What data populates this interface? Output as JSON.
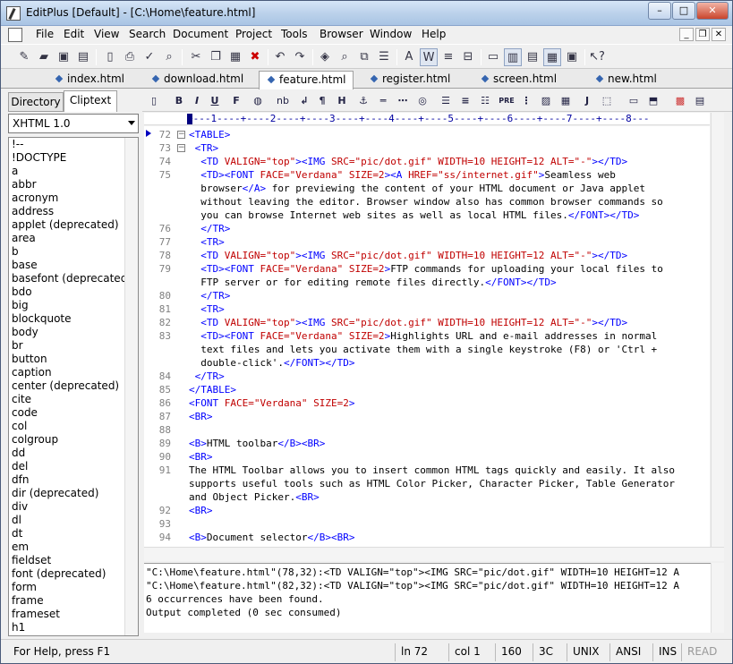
{
  "window": {
    "title": "EditPlus [Default] - [C:\\Home\\feature.html]"
  },
  "menu": [
    "File",
    "Edit",
    "View",
    "Search",
    "Document",
    "Project",
    "Tools",
    "Browser",
    "Window",
    "Help"
  ],
  "file_tabs": [
    {
      "label": "index.html",
      "active": false
    },
    {
      "label": "download.html",
      "active": false
    },
    {
      "label": "feature.html",
      "active": true
    },
    {
      "label": "register.html",
      "active": false
    },
    {
      "label": "screen.html",
      "active": false
    },
    {
      "label": "new.html",
      "active": false
    }
  ],
  "left_panel": {
    "tabs": [
      "Directory",
      "Cliptext"
    ],
    "doc_selector": "XHTML 1.0",
    "tags": [
      "!--",
      "!DOCTYPE",
      "a",
      "abbr",
      "acronym",
      "address",
      "applet (deprecated)",
      "area",
      "b",
      "base",
      "basefont (deprecated)",
      "bdo",
      "big",
      "blockquote",
      "body",
      "br",
      "button",
      "caption",
      "center (deprecated)",
      "cite",
      "code",
      "col",
      "colgroup",
      "dd",
      "del",
      "dfn",
      "dir (deprecated)",
      "div",
      "dl",
      "dt",
      "em",
      "fieldset",
      "font (deprecated)",
      "form",
      "frame",
      "frameset",
      "h1"
    ]
  },
  "html_toolbar": [
    "B",
    "I",
    "U",
    "F",
    "nb",
    "¶",
    "H"
  ],
  "ruler": "+---1----+----2----+----3----+----4----+----5----+----6----+----7----+----8---",
  "editor": {
    "lines": [
      {
        "n": "72",
        "parts": [
          [
            "tg",
            "<TABLE>"
          ]
        ]
      },
      {
        "n": "73",
        "parts": [
          [
            "tg",
            " <TR>"
          ]
        ]
      },
      {
        "n": "74",
        "parts": [
          [
            "tg",
            "  <TD "
          ],
          [
            "at",
            "VALIGN=\"top\""
          ],
          [
            "tg",
            "><IMG "
          ],
          [
            "at",
            "SRC=\"pic/dot.gif\" WIDTH=10 HEIGHT=12 ALT=\"-\""
          ],
          [
            "tg",
            "></TD>"
          ]
        ]
      },
      {
        "n": "75",
        "parts": [
          [
            "tg",
            "  <TD><FONT "
          ],
          [
            "at",
            "FACE=\"Verdana\" SIZE=2"
          ],
          [
            "tg",
            "><A "
          ],
          [
            "at",
            "HREF=\"ss/internet.gif\""
          ],
          [
            "tg",
            ">"
          ],
          [
            "tx",
            "Seamless web"
          ]
        ]
      },
      {
        "n": "",
        "parts": [
          [
            "tx",
            "  browser"
          ],
          [
            "tg",
            "</A>"
          ],
          [
            "tx",
            " for previewing the content of your HTML document or Java applet"
          ]
        ]
      },
      {
        "n": "",
        "parts": [
          [
            "tx",
            "  without leaving the editor. Browser window also has common browser commands so"
          ]
        ]
      },
      {
        "n": "",
        "parts": [
          [
            "tx",
            "  you can browse Internet web sites as well as local HTML files."
          ],
          [
            "tg",
            "</FONT></TD>"
          ]
        ]
      },
      {
        "n": "76",
        "parts": [
          [
            "tg",
            "  </TR>"
          ]
        ]
      },
      {
        "n": "77",
        "parts": [
          [
            "tg",
            "  <TR>"
          ]
        ]
      },
      {
        "n": "78",
        "parts": [
          [
            "tg",
            "  <TD "
          ],
          [
            "at",
            "VALIGN=\"top\""
          ],
          [
            "tg",
            "><IMG "
          ],
          [
            "at",
            "SRC=\"pic/dot.gif\" WIDTH=10 HEIGHT=12 ALT=\"-\""
          ],
          [
            "tg",
            "></TD>"
          ]
        ]
      },
      {
        "n": "79",
        "parts": [
          [
            "tg",
            "  <TD><FONT "
          ],
          [
            "at",
            "FACE=\"Verdana\" SIZE=2"
          ],
          [
            "tg",
            ">"
          ],
          [
            "tx",
            "FTP commands for uploading your local files to"
          ]
        ]
      },
      {
        "n": "",
        "parts": [
          [
            "tx",
            "  FTP server or for editing remote files directly."
          ],
          [
            "tg",
            "</FONT></TD>"
          ]
        ]
      },
      {
        "n": "80",
        "parts": [
          [
            "tg",
            "  </TR>"
          ]
        ]
      },
      {
        "n": "81",
        "parts": [
          [
            "tg",
            "  <TR>"
          ]
        ]
      },
      {
        "n": "82",
        "parts": [
          [
            "tg",
            "  <TD "
          ],
          [
            "at",
            "VALIGN=\"top\""
          ],
          [
            "tg",
            "><IMG "
          ],
          [
            "at",
            "SRC=\"pic/dot.gif\" WIDTH=10 HEIGHT=12 ALT=\"-\""
          ],
          [
            "tg",
            "></TD>"
          ]
        ]
      },
      {
        "n": "83",
        "parts": [
          [
            "tg",
            "  <TD><FONT "
          ],
          [
            "at",
            "FACE=\"Verdana\" SIZE=2"
          ],
          [
            "tg",
            ">"
          ],
          [
            "tx",
            "Highlights URL and e-mail addresses in normal"
          ]
        ]
      },
      {
        "n": "",
        "parts": [
          [
            "tx",
            "  text files and lets you activate them with a single keystroke (F8) or 'Ctrl +"
          ]
        ]
      },
      {
        "n": "",
        "parts": [
          [
            "tx",
            "  double-click'."
          ],
          [
            "tg",
            "</FONT></TD>"
          ]
        ]
      },
      {
        "n": "84",
        "parts": [
          [
            "tg",
            " </TR>"
          ]
        ]
      },
      {
        "n": "85",
        "parts": [
          [
            "tg",
            "</TABLE>"
          ]
        ]
      },
      {
        "n": "86",
        "parts": [
          [
            "tg",
            "<FONT "
          ],
          [
            "at",
            "FACE=\"Verdana\" SIZE=2"
          ],
          [
            "tg",
            ">"
          ]
        ]
      },
      {
        "n": "87",
        "parts": [
          [
            "tg",
            "<BR>"
          ]
        ]
      },
      {
        "n": "88",
        "parts": []
      },
      {
        "n": "89",
        "parts": [
          [
            "tg",
            "<B>"
          ],
          [
            "tx",
            "HTML toolbar"
          ],
          [
            "tg",
            "</B><BR>"
          ]
        ]
      },
      {
        "n": "90",
        "parts": [
          [
            "tg",
            "<BR>"
          ]
        ]
      },
      {
        "n": "91",
        "parts": [
          [
            "tx",
            "The HTML Toolbar allows you to insert common HTML tags quickly and easily. It also"
          ]
        ]
      },
      {
        "n": "",
        "parts": [
          [
            "tx",
            "supports useful tools such as HTML Color Picker, Character Picker, Table Generator"
          ]
        ]
      },
      {
        "n": "",
        "parts": [
          [
            "tx",
            "and Object Picker."
          ],
          [
            "tg",
            "<BR>"
          ]
        ]
      },
      {
        "n": "92",
        "parts": [
          [
            "tg",
            "<BR>"
          ]
        ]
      },
      {
        "n": "93",
        "parts": []
      },
      {
        "n": "94",
        "parts": [
          [
            "tg",
            "<B>"
          ],
          [
            "tx",
            "Document selector"
          ],
          [
            "tg",
            "</B><BR>"
          ]
        ]
      }
    ]
  },
  "output": [
    "\"C:\\Home\\feature.html\"(78,32):<TD VALIGN=\"top\"><IMG SRC=\"pic/dot.gif\" WIDTH=10 HEIGHT=12 A",
    "\"C:\\Home\\feature.html\"(82,32):<TD VALIGN=\"top\"><IMG SRC=\"pic/dot.gif\" WIDTH=10 HEIGHT=12 A",
    "6 occurrences have been found.",
    "Output completed (0 sec consumed)"
  ],
  "status": {
    "help": "For Help, press F1",
    "line": "ln 72",
    "col": "col 1",
    "chars": "160",
    "hex": "3C",
    "eol": "UNIX",
    "enc": "ANSI",
    "ins": "INS",
    "read": "READ"
  }
}
